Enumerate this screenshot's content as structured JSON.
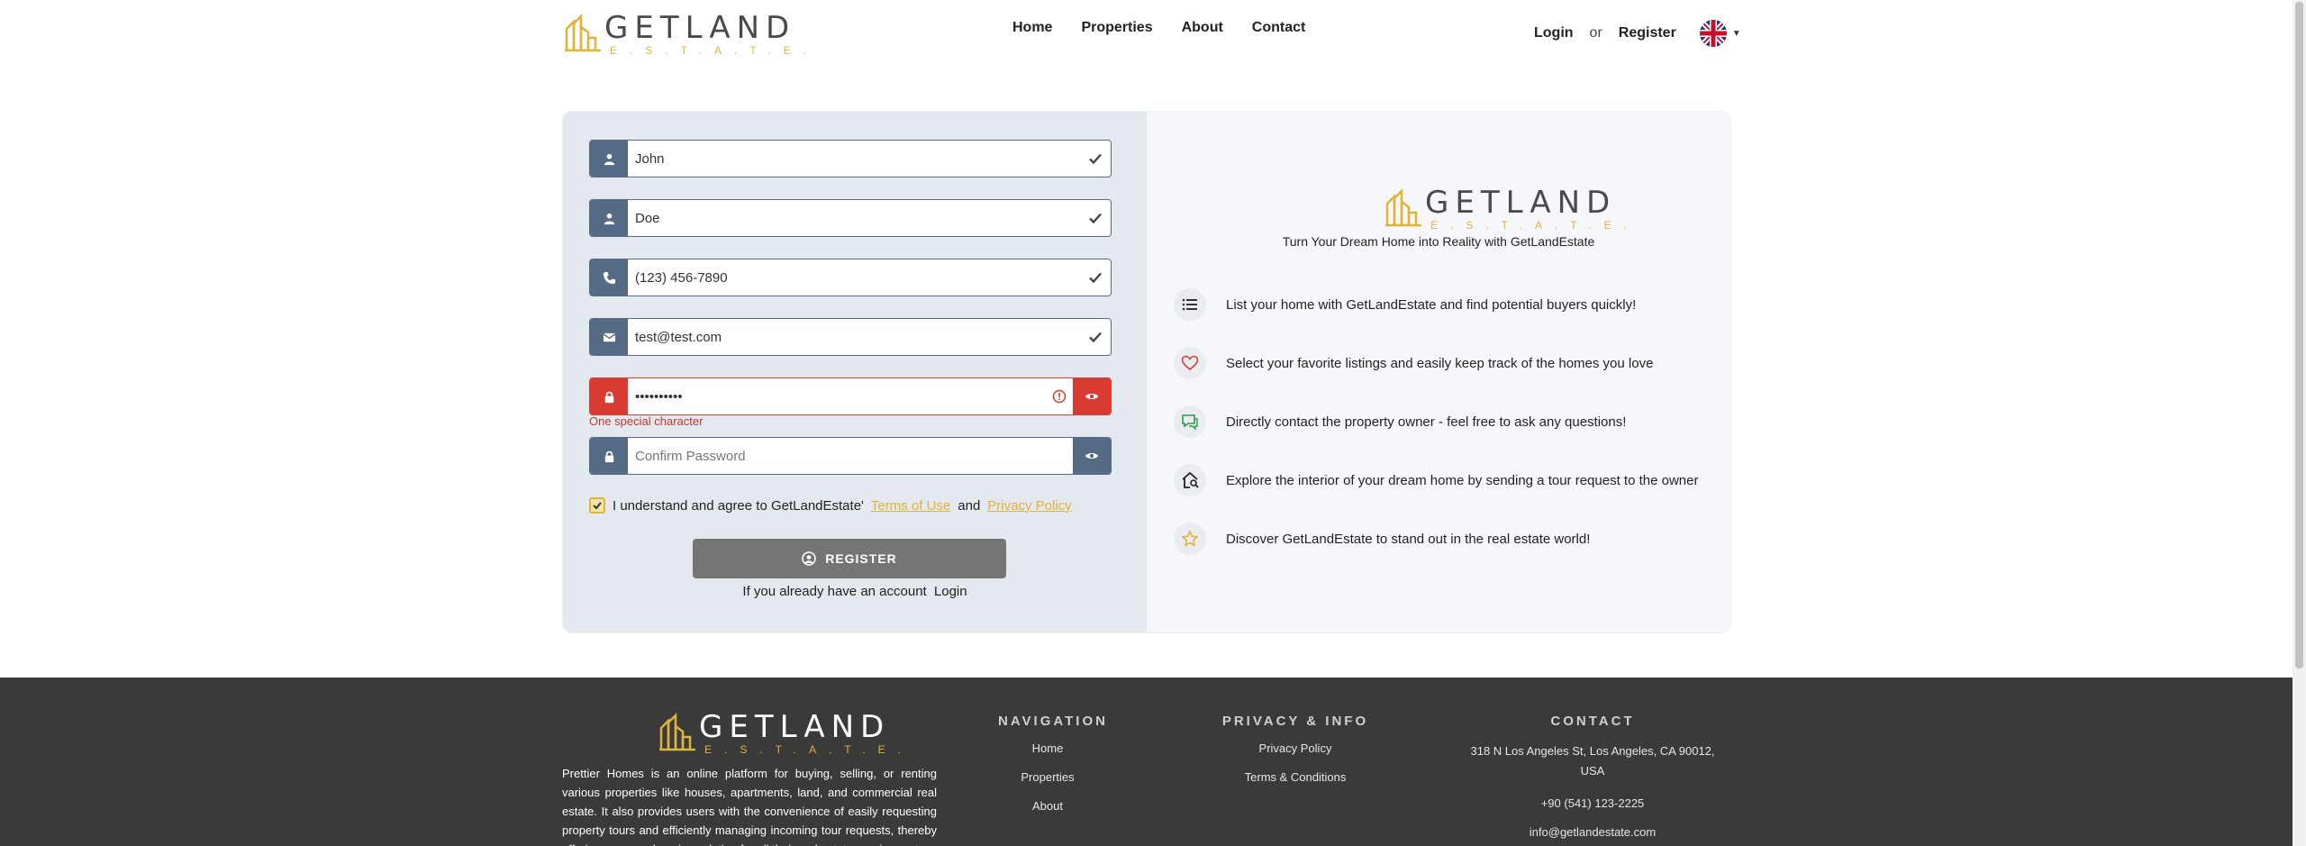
{
  "brand": {
    "name": "GETLAND",
    "sub": "E.S.T.A.T.E."
  },
  "nav": {
    "home": "Home",
    "properties": "Properties",
    "about": "About",
    "contact": "Contact"
  },
  "auth": {
    "login": "Login",
    "or": "or",
    "register": "Register"
  },
  "form": {
    "first_name": "John",
    "last_name": "Doe",
    "phone": "(123) 456-7890",
    "email": "test@test.com",
    "password": "••••••••••",
    "password_error": "One special character",
    "confirm_placeholder": "Confirm Password",
    "agree_prefix": "I understand and agree to GetLandEstate'",
    "terms": "Terms of Use",
    "and": "and",
    "privacy": "Privacy Policy",
    "register_btn": "REGISTER",
    "have_account": "If you already have an account",
    "login_link": "Login"
  },
  "right": {
    "tagline": "Turn Your Dream Home into Reality with GetLandEstate",
    "features": [
      {
        "icon": "list-icon",
        "text": "List your home with GetLandEstate and find potential buyers quickly!"
      },
      {
        "icon": "heart-icon",
        "text": "Select your favorite listings and easily keep track of the homes you love"
      },
      {
        "icon": "chat-icon",
        "text": "Directly contact the property owner - feel free to ask any questions!"
      },
      {
        "icon": "house-search-icon",
        "text": "Explore the interior of your dream home by sending a tour request to the owner"
      },
      {
        "icon": "star-icon",
        "text": "Discover GetLandEstate to stand out in the real estate world!"
      }
    ]
  },
  "footer": {
    "description": "Prettier Homes is an online platform for buying, selling, or renting various properties like houses, apartments, land, and commercial real estate. It also provides users with the convenience of easily requesting property tours and efficiently managing incoming tour requests, thereby offering a comprehensive solution for all their real estate requirements.",
    "nav_title": "NAVIGATION",
    "nav_items": [
      "Home",
      "Properties",
      "About"
    ],
    "privacy_title": "PRIVACY & INFO",
    "privacy_items": [
      "Privacy Policy",
      "Terms & Conditions"
    ],
    "contact_title": "CONTACT",
    "address": "318 N Los Angeles St, Los Angeles, CA 90012, USA",
    "phone": "+90 (541) 123-2225",
    "email": "info@getlandestate.com"
  },
  "colors": {
    "accent": "#e0b33a",
    "addon": "#546a85",
    "error": "#d93a32",
    "footer": "#3a3a3a"
  }
}
